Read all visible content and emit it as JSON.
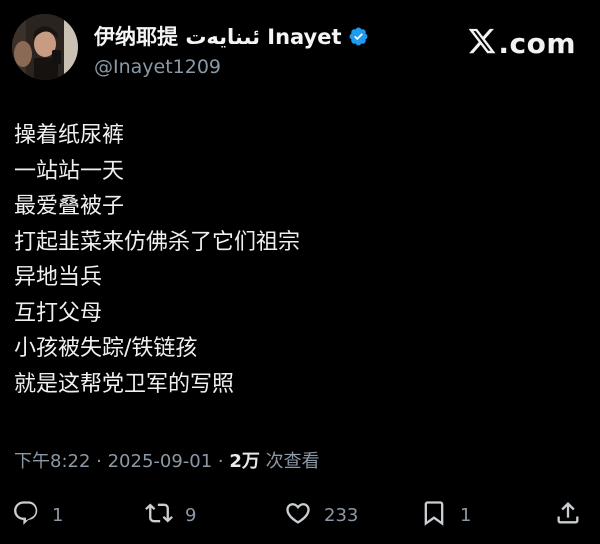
{
  "header": {
    "display_name": "伊纳耶提 ئىنايەت Inayet",
    "handle": "@Inayet1209",
    "brand": "X.com",
    "verified_color": "#1d9bf0"
  },
  "post": {
    "lines": [
      "操着纸尿裤",
      "一站站一天",
      "最爱叠被子",
      "打起韭菜来仿佛杀了它们祖宗",
      "异地当兵",
      "互打父母",
      "小孩被失踪/铁链孩",
      "就是这帮党卫军的写照"
    ]
  },
  "meta": {
    "time": "下午8:22",
    "date": "2025-09-01",
    "separator": " · ",
    "views_count": "2万",
    "views_label": " 次查看"
  },
  "actions": {
    "replies": "1",
    "reposts": "9",
    "likes": "233",
    "bookmarks": "1"
  },
  "icons": [
    "verified-badge-icon",
    "x-logo-icon",
    "reply-icon",
    "repost-icon",
    "like-icon",
    "bookmark-icon",
    "share-icon"
  ]
}
